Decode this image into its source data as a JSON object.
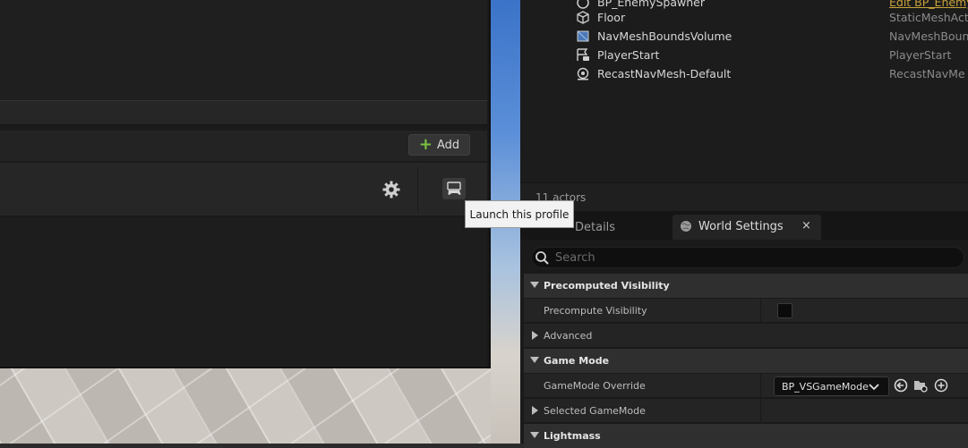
{
  "launcher": {
    "add_label": "Add",
    "tooltip": "Launch this profile"
  },
  "outliner": {
    "rows": [
      {
        "label": "BP_EnemySpawner",
        "type": "Edit BP_Enemy"
      },
      {
        "label": "Floor",
        "type": "StaticMeshAct"
      },
      {
        "label": "NavMeshBoundsVolume",
        "type": "NavMeshBoun"
      },
      {
        "label": "PlayerStart",
        "type": "PlayerStart"
      },
      {
        "label": "RecastNavMesh-Default",
        "type": "RecastNavMe"
      }
    ],
    "actor_count": "11 actors"
  },
  "tabs": {
    "details": "Details",
    "world_settings": "World Settings",
    "close": "×"
  },
  "details": {
    "search_placeholder": "Search",
    "precomputed_visibility": "Precomputed Visibility",
    "precompute_visibility": "Precompute Visibility",
    "advanced": "Advanced",
    "game_mode": "Game Mode",
    "gamemode_override": "GameMode Override",
    "gamemode_value": "BP_VSGameMode",
    "selected_gamemode": "Selected GameMode",
    "lightmass": "Lightmass"
  },
  "colors": {
    "accent_green": "#7cc242",
    "panel": "#1a1a1a"
  }
}
